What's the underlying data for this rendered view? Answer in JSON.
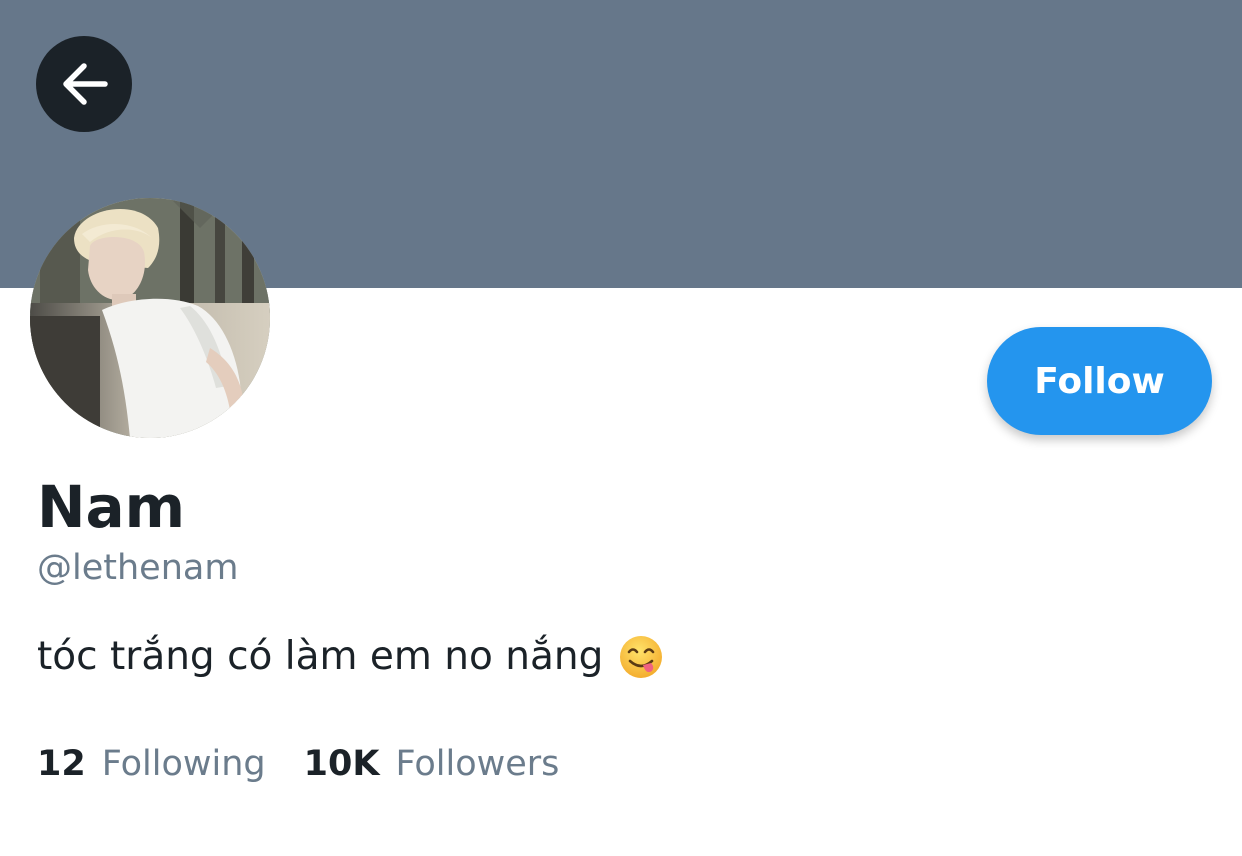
{
  "header": {
    "banner_color": "#66778a",
    "back_icon": "arrow-left-icon"
  },
  "profile": {
    "display_name": "Nam",
    "handle": "@lethenam",
    "bio": "tóc trắng có làm em no nắng",
    "bio_emoji": "face-savoring-food-emoji",
    "avatar": "profile-photo"
  },
  "actions": {
    "follow_label": "Follow",
    "accent_color": "#2495ee"
  },
  "stats": {
    "following_count": "12",
    "following_label": "Following",
    "followers_count": "10K",
    "followers_label": "Followers"
  }
}
